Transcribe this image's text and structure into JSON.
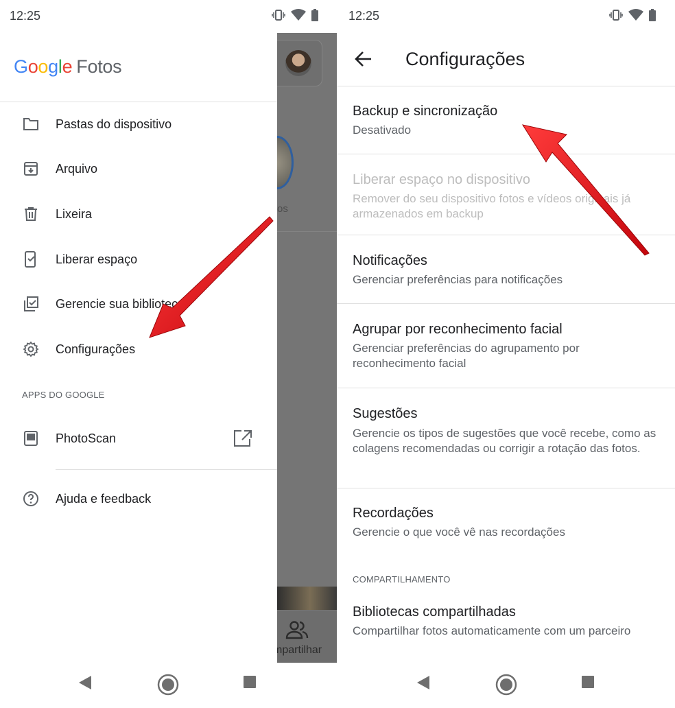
{
  "left": {
    "status": {
      "time": "12:25"
    },
    "logo": {
      "g1": "G",
      "g2": "o",
      "g3": "o",
      "g4": "g",
      "g5": "l",
      "g6": "e",
      "product": "Fotos"
    },
    "menu": [
      {
        "label": "Pastas do dispositivo",
        "icon": "folder-icon"
      },
      {
        "label": "Arquivo",
        "icon": "archive-icon"
      },
      {
        "label": "Lixeira",
        "icon": "trash-icon"
      },
      {
        "label": "Liberar espaço",
        "icon": "free-space-icon"
      },
      {
        "label": "Gerencie sua biblioteca",
        "icon": "manage-library-icon"
      },
      {
        "label": "Configurações",
        "icon": "gear-icon"
      }
    ],
    "section_label": "APPS DO GOOGLE",
    "apps": [
      {
        "label": "PhotoScan",
        "icon": "photoscan-icon",
        "trailing_icon": "open-external-icon"
      }
    ],
    "help": {
      "label": "Ajuda e feedback",
      "icon": "help-icon"
    },
    "background": {
      "partial_label": "os",
      "share_label": "mpartilhar"
    }
  },
  "right": {
    "status": {
      "time": "12:25"
    },
    "app_bar": {
      "title": "Configurações"
    },
    "settings": [
      {
        "title": "Backup e sincronização",
        "subtitle": "Desativado",
        "enabled": true
      },
      {
        "title": "Liberar espaço no dispositivo",
        "subtitle": "Remover do seu dispositivo fotos e vídeos originais já armazenados em backup",
        "enabled": false
      },
      {
        "title": "Notificações",
        "subtitle": "Gerenciar preferências para notificações",
        "enabled": true
      },
      {
        "title": "Agrupar por reconhecimento facial",
        "subtitle": "Gerenciar preferências do agrupamento por reconhecimento facial",
        "enabled": true
      },
      {
        "title": "Sugestões",
        "subtitle": "Gerencie os tipos de sugestões que você recebe, como as colagens recomendadas ou corrigir a rotação das fotos.",
        "enabled": true
      },
      {
        "title": "Recordações",
        "subtitle": "Gerencie o que você vê nas recordações",
        "enabled": true
      }
    ],
    "section_label": "COMPARTILHAMENTO",
    "shared": {
      "title": "Bibliotecas compartilhadas",
      "subtitle": "Compartilhar fotos automaticamente com um parceiro"
    }
  },
  "colors": {
    "arrow": "#e3141b",
    "google_blue": "#4285f4",
    "google_red": "#ea4335",
    "google_yellow": "#fbbc05",
    "google_green": "#34a853",
    "scrim": "#757575"
  }
}
